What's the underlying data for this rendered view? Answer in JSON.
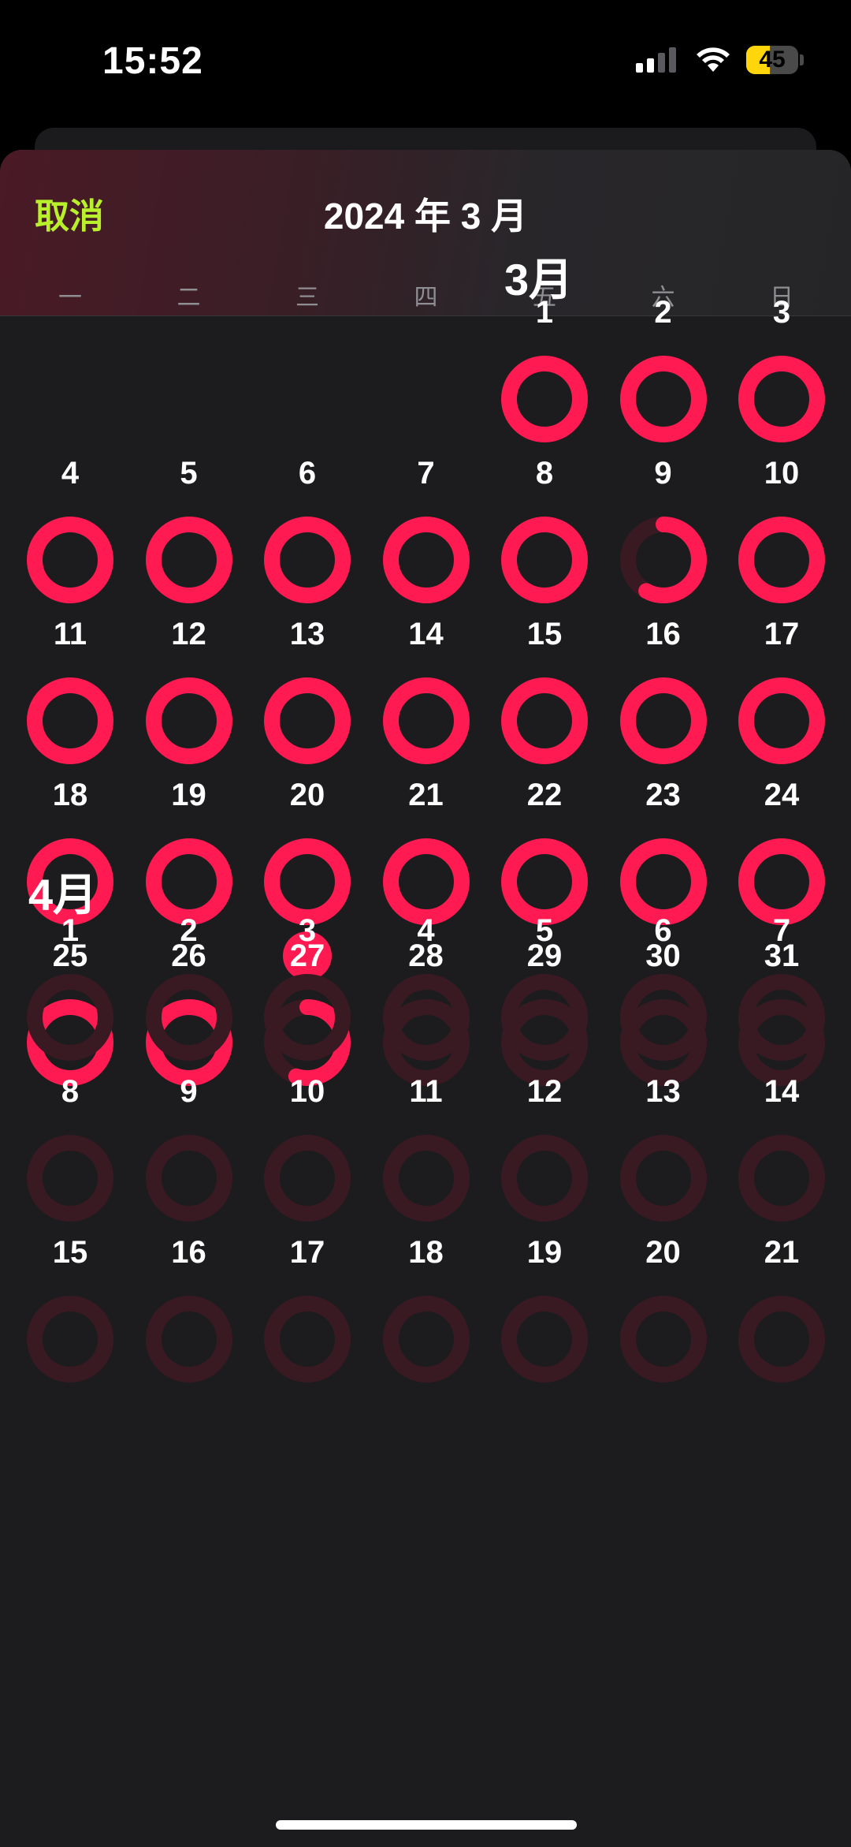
{
  "status_bar": {
    "time": "15:52",
    "battery": "45",
    "battery_level": 0.45
  },
  "header": {
    "cancel_label": "取消",
    "title": "2024 年 3 月"
  },
  "weekdays": [
    "一",
    "二",
    "三",
    "四",
    "五",
    "六",
    "日"
  ],
  "colors": {
    "accent": "#ff1a52",
    "ring_track": "#3a1a22",
    "cancel": "#b8f02c"
  },
  "months": [
    {
      "title": "3月",
      "first_weekday": 4,
      "today": 27,
      "days": [
        {
          "day": 1,
          "progress": 1
        },
        {
          "day": 2,
          "progress": 1
        },
        {
          "day": 3,
          "progress": 1
        },
        {
          "day": 4,
          "progress": 1
        },
        {
          "day": 5,
          "progress": 1
        },
        {
          "day": 6,
          "progress": 1
        },
        {
          "day": 7,
          "progress": 1
        },
        {
          "day": 8,
          "progress": 1
        },
        {
          "day": 9,
          "progress": 0.58
        },
        {
          "day": 10,
          "progress": 1
        },
        {
          "day": 11,
          "progress": 1
        },
        {
          "day": 12,
          "progress": 1
        },
        {
          "day": 13,
          "progress": 1
        },
        {
          "day": 14,
          "progress": 1
        },
        {
          "day": 15,
          "progress": 1
        },
        {
          "day": 16,
          "progress": 1
        },
        {
          "day": 17,
          "progress": 1
        },
        {
          "day": 18,
          "progress": 1
        },
        {
          "day": 19,
          "progress": 1
        },
        {
          "day": 20,
          "progress": 1
        },
        {
          "day": 21,
          "progress": 1
        },
        {
          "day": 22,
          "progress": 1
        },
        {
          "day": 23,
          "progress": 1
        },
        {
          "day": 24,
          "progress": 1
        },
        {
          "day": 25,
          "progress": 1
        },
        {
          "day": 26,
          "progress": 1
        },
        {
          "day": 27,
          "progress": 0.55
        },
        {
          "day": 28,
          "progress": 0
        },
        {
          "day": 29,
          "progress": 0
        },
        {
          "day": 30,
          "progress": 0
        },
        {
          "day": 31,
          "progress": 0
        }
      ]
    },
    {
      "title": "4月",
      "first_weekday": 0,
      "days": [
        {
          "day": 1,
          "progress": 0
        },
        {
          "day": 2,
          "progress": 0
        },
        {
          "day": 3,
          "progress": 0
        },
        {
          "day": 4,
          "progress": 0
        },
        {
          "day": 5,
          "progress": 0
        },
        {
          "day": 6,
          "progress": 0
        },
        {
          "day": 7,
          "progress": 0
        },
        {
          "day": 8,
          "progress": 0
        },
        {
          "day": 9,
          "progress": 0
        },
        {
          "day": 10,
          "progress": 0
        },
        {
          "day": 11,
          "progress": 0
        },
        {
          "day": 12,
          "progress": 0
        },
        {
          "day": 13,
          "progress": 0
        },
        {
          "day": 14,
          "progress": 0
        },
        {
          "day": 15,
          "progress": 0
        },
        {
          "day": 16,
          "progress": 0
        },
        {
          "day": 17,
          "progress": 0
        },
        {
          "day": 18,
          "progress": 0
        },
        {
          "day": 19,
          "progress": 0
        },
        {
          "day": 20,
          "progress": 0
        },
        {
          "day": 21,
          "progress": 0
        }
      ]
    }
  ]
}
